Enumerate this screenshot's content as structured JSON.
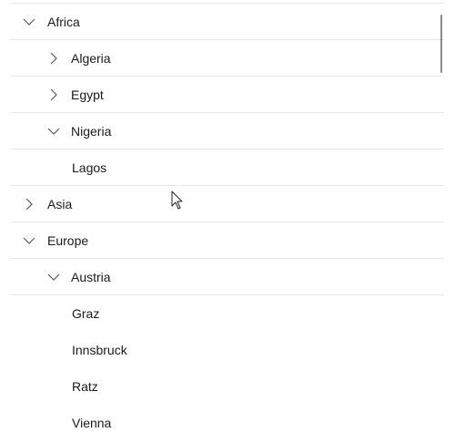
{
  "tree": {
    "africa": {
      "label": "Africa",
      "expanded": true
    },
    "algeria": {
      "label": "Algeria",
      "expanded": false
    },
    "egypt": {
      "label": "Egypt",
      "expanded": false
    },
    "nigeria": {
      "label": "Nigeria",
      "expanded": true
    },
    "lagos": {
      "label": "Lagos"
    },
    "asia": {
      "label": "Asia",
      "expanded": false
    },
    "europe": {
      "label": "Europe",
      "expanded": true
    },
    "austria": {
      "label": "Austria",
      "expanded": true
    },
    "graz": {
      "label": "Graz"
    },
    "innsbruck": {
      "label": "Innsbruck"
    },
    "ratz": {
      "label": "Ratz"
    },
    "vienna": {
      "label": "Vienna"
    }
  },
  "icons": {
    "expanded": "chevron-down-icon",
    "collapsed": "chevron-right-icon"
  },
  "colors": {
    "separator": "#e5e5e5",
    "text": "#1a1a1a",
    "chevron": "#5a5a5a",
    "scrollbar": "#8a8a8a"
  }
}
